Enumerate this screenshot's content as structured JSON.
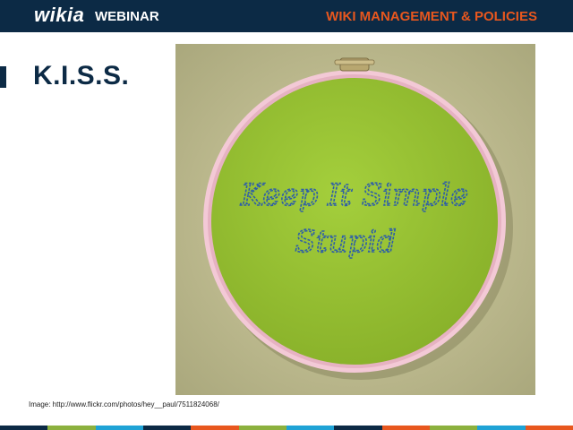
{
  "header": {
    "logo": "wikia",
    "product": "WEBINAR",
    "section": "WIKI MANAGEMENT & POLICIES"
  },
  "slide": {
    "title": "K.I.S.S.",
    "image": {
      "embroidery_line1": "Keep It Simple",
      "embroidery_line2": "Stupid"
    },
    "caption": "Image: http://www.flickr.com/photos/hey__paul/7511824068/"
  },
  "colors": {
    "navy": "#0c2a45",
    "orange": "#e8571e",
    "footer_stripes": [
      "#0c2a45",
      "#8cb13e",
      "#1fa3d6",
      "#0c2a45",
      "#e8571e",
      "#8cb13e",
      "#1fa3d6",
      "#0c2a45",
      "#e8571e",
      "#8cb13e",
      "#1fa3d6",
      "#e8571e"
    ]
  }
}
